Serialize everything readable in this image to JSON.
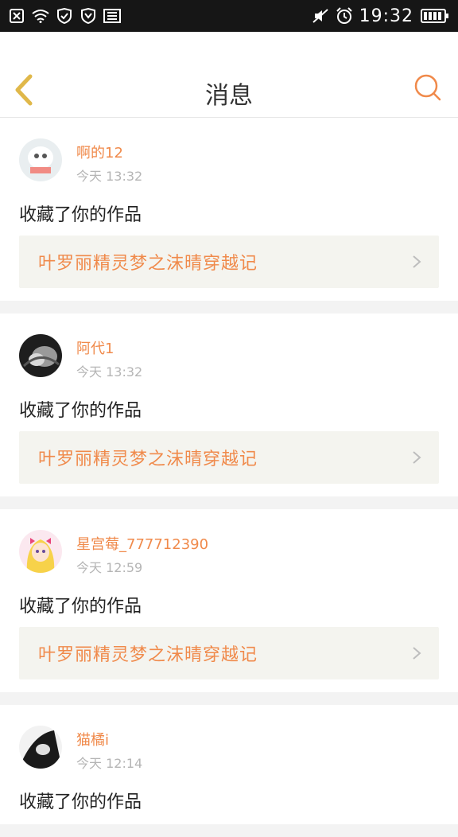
{
  "status_bar": {
    "time": "19:32",
    "left_icons": [
      "notification-close-icon",
      "wifi-icon",
      "shield-check-icon",
      "shield-icon",
      "news-icon"
    ],
    "right_icons": [
      "mute-icon",
      "alarm-icon",
      "battery-icon"
    ]
  },
  "header": {
    "title": "消息",
    "back_icon": "chevron-left-icon",
    "search_icon": "search-icon",
    "accent": "#f08a4b",
    "back_color": "#e0b84a"
  },
  "messages": [
    {
      "username": "啊的12",
      "time": "今天 13:32",
      "action": "收藏了你的作品",
      "work_title": "叶罗丽精灵梦之沫晴穿越记",
      "avatar": "avatar-photo-1"
    },
    {
      "username": "阿代1",
      "time": "今天 13:32",
      "action": "收藏了你的作品",
      "work_title": "叶罗丽精灵梦之沫晴穿越记",
      "avatar": "avatar-photo-2"
    },
    {
      "username": "星宫莓_777712390",
      "time": "今天 12:59",
      "action": "收藏了你的作品",
      "work_title": "叶罗丽精灵梦之沫晴穿越记",
      "avatar": "avatar-photo-3"
    },
    {
      "username": "猫橘i",
      "time": "今天 12:14",
      "action": "收藏了你的作品",
      "avatar": "avatar-photo-4"
    }
  ]
}
